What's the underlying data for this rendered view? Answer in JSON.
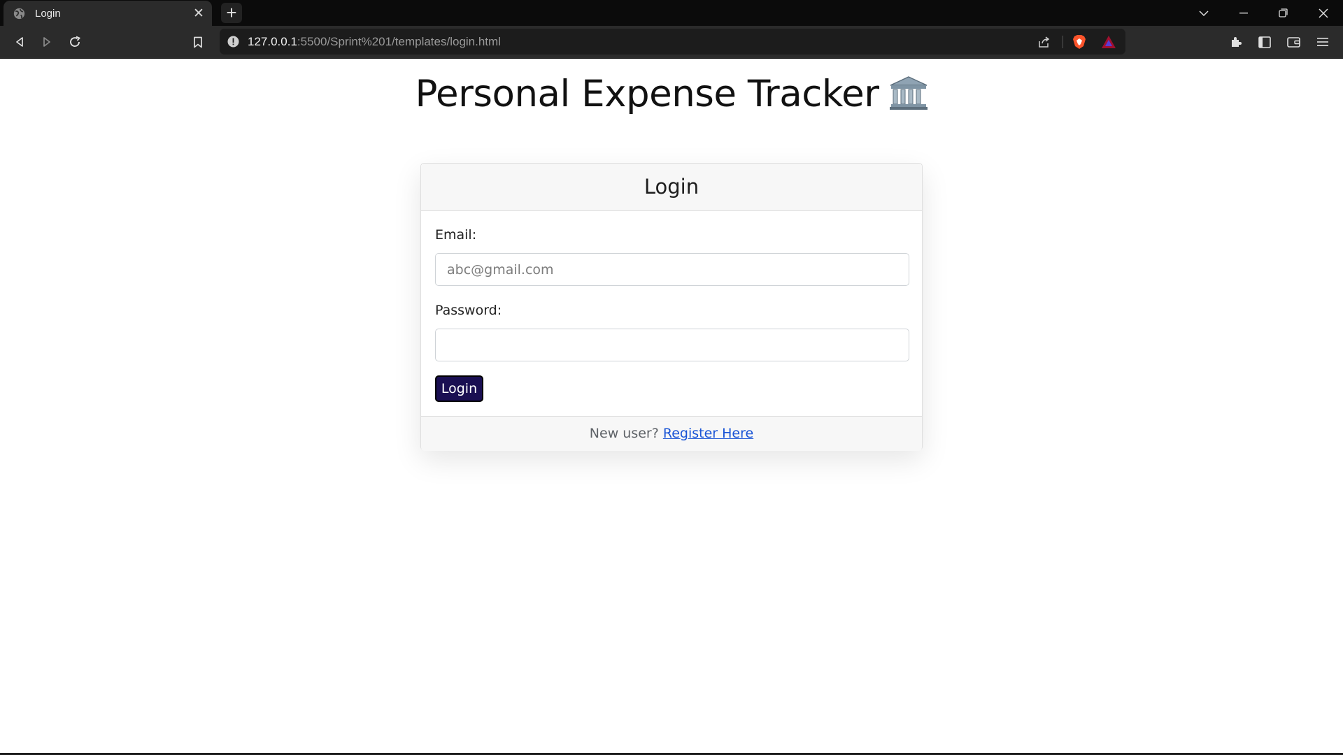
{
  "browser": {
    "tab": {
      "title": "Login",
      "favicon": "globe-icon"
    },
    "new_tab_symbol": "+",
    "address": {
      "host": "127.0.0.1",
      "rest": ":5500/Sprint%201/templates/login.html"
    },
    "icons": [
      "back-icon",
      "forward-icon",
      "reload-icon",
      "bookmark-icon",
      "site-info-icon",
      "share-icon",
      "brave-shield-icon",
      "brave-rewards-icon",
      "extensions-icon",
      "sidebar-icon",
      "wallet-icon",
      "menu-icon"
    ]
  },
  "page": {
    "title": "Personal Expense Tracker",
    "title_emoji": "🏛️",
    "card": {
      "header": "Login",
      "email_label": "Email:",
      "email_placeholder": "abc@gmail.com",
      "email_value": "",
      "password_label": "Password:",
      "password_value": "",
      "login_button": "Login",
      "footer_text": "New user?",
      "register_link": "Register Here"
    }
  },
  "colors": {
    "button_bg": "#1a0f52",
    "link": "#1a55d6",
    "card_header_bg": "#f7f7f7"
  }
}
